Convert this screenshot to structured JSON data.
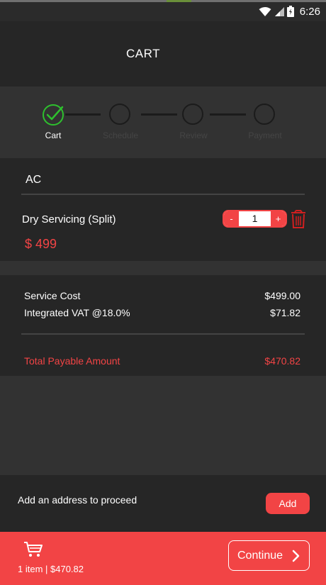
{
  "status_bar": {
    "time": "6:26"
  },
  "header": {
    "title": "CART"
  },
  "steps": [
    {
      "label": "Cart",
      "state": "done"
    },
    {
      "label": "Schedule",
      "state": "pending"
    },
    {
      "label": "Review",
      "state": "pending"
    },
    {
      "label": "Payment",
      "state": "pending"
    }
  ],
  "category": {
    "title": "AC"
  },
  "item": {
    "name": "Dry Servicing (Split)",
    "price": "$ 499",
    "quantity": "1",
    "minus_label": "-",
    "plus_label": "+"
  },
  "costs": {
    "service_cost_label": "Service Cost",
    "service_cost_value": "$499.00",
    "vat_label": "Integrated VAT @18.0%",
    "vat_value": "$71.82",
    "total_label": "Total Payable Amount",
    "total_value": "$470.82"
  },
  "address": {
    "prompt": "Add an address to proceed",
    "add_label": "Add"
  },
  "bottom_bar": {
    "summary": "1 item | $470.82",
    "continue_label": "Continue"
  },
  "colors": {
    "accent": "#f24445",
    "success": "#2ec02e",
    "background": "#262626",
    "band": "#323232"
  }
}
